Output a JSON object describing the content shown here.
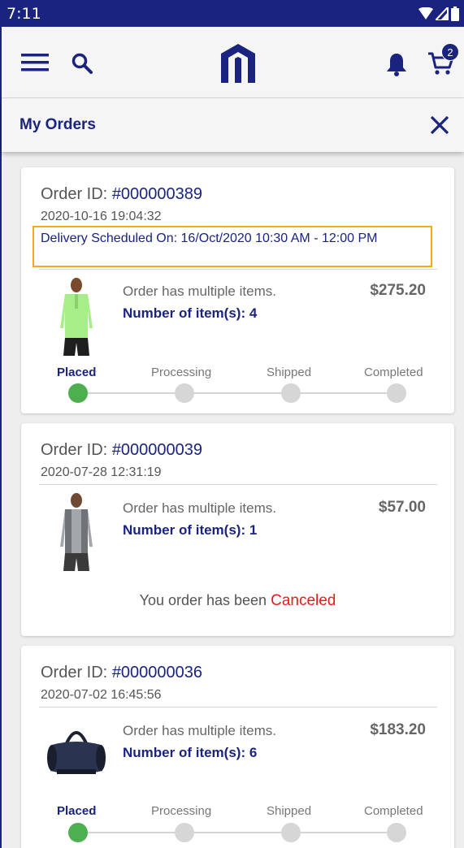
{
  "status_bar": {
    "time": "7:11"
  },
  "toolbar": {
    "menu_icon": "hamburger-menu-icon",
    "search_icon": "search-icon",
    "logo_icon": "magento-logo-icon",
    "bell_icon": "notification-bell-icon",
    "cart_icon": "cart-icon",
    "cart_count": "2"
  },
  "page": {
    "title": "My Orders",
    "close_icon": "close-icon"
  },
  "colors": {
    "primary": "#1a237e",
    "active_step": "#4caf50",
    "inactive_step": "#d6d6d6",
    "highlight": "#f4a91a",
    "canceled": "#f41616"
  },
  "orders": [
    {
      "id_label": "Order ID:",
      "id": "#000000389",
      "date": "2020-10-16 19:04:32",
      "delivery": "Delivery Scheduled On: 16/Oct/2020 10:30 AM - 12:00 PM",
      "summary": "Order has multiple items.",
      "count_label": "Number of item(s): 4",
      "price": "$275.20",
      "steps": [
        "Placed",
        "Processing",
        "Shipped",
        "Completed"
      ],
      "active_step": 0
    },
    {
      "id_label": "Order ID:",
      "id": "#000000039",
      "date": "2020-07-28 12:31:19",
      "summary": "Order has multiple items.",
      "count_label": "Number of item(s): 1",
      "price": "$57.00",
      "cancel_prefix": "You order has been",
      "cancel_status": "Canceled"
    },
    {
      "id_label": "Order ID:",
      "id": "#000000036",
      "date": "2020-07-02 16:45:56",
      "summary": "Order has multiple items.",
      "count_label": "Number of item(s): 6",
      "price": "$183.20",
      "steps": [
        "Placed",
        "Processing",
        "Shipped",
        "Completed"
      ],
      "active_step": 0
    }
  ]
}
